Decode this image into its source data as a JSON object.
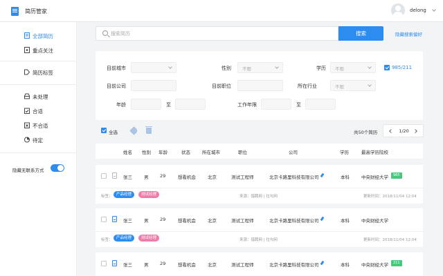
{
  "app": {
    "title": "简历管家",
    "username": "delong"
  },
  "sidebar": {
    "items": [
      {
        "label": "全部简历",
        "icon": "all-resumes-icon",
        "active": true
      },
      {
        "label": "重点关注",
        "icon": "star-doc-icon"
      },
      {
        "label": "简历标签",
        "icon": "tag-icon"
      },
      {
        "label": "未处理",
        "icon": "inbox-icon"
      },
      {
        "label": "合适",
        "icon": "clipboard-check-icon"
      },
      {
        "label": "不合适",
        "icon": "clipboard-x-icon"
      },
      {
        "label": "待定",
        "icon": "pie-icon"
      }
    ],
    "hide_contact_label": "隐藏无联系方式",
    "hide_contact_on": true
  },
  "search": {
    "placeholder": "搜索简历",
    "button": "搜索",
    "pref_link": "隐藏搜索偏好"
  },
  "filters": {
    "city_label": "目前城市",
    "gender_label": "性别",
    "gender_value": "不限",
    "edu_label": "学历",
    "edu_value": "不限",
    "school_check_label": "985/211",
    "company_label": "目前公司",
    "position_label": "目前职位",
    "industry_label": "所在行业",
    "industry_value": "不限",
    "age_label": "年龄",
    "to": "至",
    "exp_label": "工作年限"
  },
  "toolbar": {
    "select_all": "全选",
    "total": "共50个简历",
    "page": "1/20"
  },
  "table": {
    "headers": [
      "姓名",
      "性别",
      "年龄",
      "状态",
      "所在城市",
      "职位",
      "公司",
      "学历",
      "最高学历院校"
    ],
    "tag_label": "标签：",
    "rows": [
      {
        "name": "张三",
        "gender": "男",
        "age": "29",
        "status": "想看机会",
        "city": "北京",
        "position": "测试工程师",
        "company": "北京卡路里科技有限公司",
        "edu": "本科",
        "school": "中央财经大学",
        "badge": "985",
        "tags": [
          "产品经理",
          "测试经理"
        ],
        "source": "来源：猎聘网 | 拉勾网",
        "updated": "更新时间：2018/11/04 12:04"
      },
      {
        "name": "张三",
        "gender": "男",
        "age": "29",
        "status": "想看机会",
        "city": "北京",
        "position": "测试工程师",
        "company": "北京卡路里科技有限公司",
        "edu": "本科",
        "school": "中央财经大学",
        "badge": "",
        "tags": [
          "产品经理",
          "测试经理"
        ],
        "source": "来源：猎聘网 | 拉勾网",
        "updated": "更新时间：2018/11/04 12:04"
      },
      {
        "name": "张三",
        "gender": "男",
        "age": "29",
        "status": "想看机会",
        "city": "北京",
        "position": "测试工程师",
        "company": "北京卡路里科技有限公司",
        "edu": "本科",
        "school": "中央财经大学",
        "badge": "211",
        "tags": [],
        "source": "",
        "updated": ""
      }
    ]
  },
  "colors": {
    "accent": "#2d8cf0",
    "chip_blue": "#2d8cf0",
    "chip_pink": "#f07aa8",
    "badge_green": "#47c87c"
  }
}
